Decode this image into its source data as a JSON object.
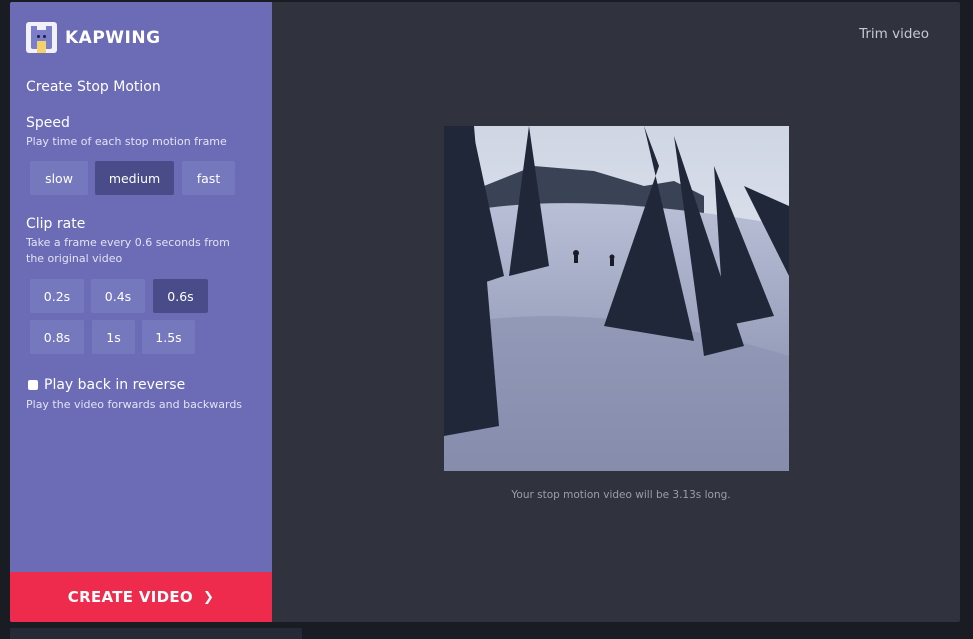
{
  "app": {
    "brand": "KAPWING",
    "logo_icon": "kapwing-bear-logo"
  },
  "header": {
    "trim_label": "Trim video"
  },
  "sidebar": {
    "title": "Create Stop Motion",
    "speed": {
      "title": "Speed",
      "description": "Play time of each stop motion frame",
      "options": [
        "slow",
        "medium",
        "fast"
      ],
      "selected": "medium"
    },
    "clip_rate": {
      "title": "Clip rate",
      "description": "Take a frame every 0.6 seconds from the original video",
      "options": [
        "0.2s",
        "0.4s",
        "0.6s",
        "0.8s",
        "1s",
        "1.5s"
      ],
      "selected": "0.6s"
    },
    "reverse": {
      "label": "Play back in reverse",
      "description": "Play the video forwards and backwards",
      "checked": false
    },
    "create_button": {
      "label": "CREATE VIDEO",
      "icon": "chevron-right-icon"
    }
  },
  "preview": {
    "caption": "Your stop motion video will be 3.13s long."
  },
  "colors": {
    "sidebar_bg": "#6b6cb5",
    "selected_option": "#4a4c8a",
    "create_button": "#ee2a4d",
    "main_bg": "#30333e"
  }
}
